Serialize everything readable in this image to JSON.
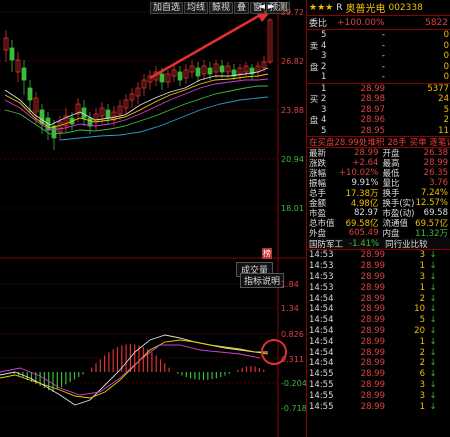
{
  "toolbar": {
    "buttons": [
      "加自选",
      "均线",
      "鲸视",
      "叠",
      "窗",
      "预测"
    ],
    "nav_arrows": "◄ ►"
  },
  "chart": {
    "price_axis": [
      "29.72",
      "26.82",
      "23.88",
      "20.94",
      "18.01"
    ],
    "indicator_axis": [
      "1.84",
      "1.34",
      "0.826",
      "0.311",
      "-0.204",
      "-0.718"
    ],
    "volume_tab": "成交量",
    "indicator_tab": "指标说明",
    "history_mark": "榜"
  },
  "panel": {
    "stars": "★★★",
    "r_mark": "R",
    "name": "奥普光电",
    "code": "002338",
    "weibi_label": "委比",
    "weibi_pct": "+100.00%",
    "weibi_val": "5822",
    "sell_side_label": [
      "卖",
      "盘"
    ],
    "buy_side_label": [
      "买",
      "盘"
    ],
    "sell_orders": [
      {
        "lvl": "5",
        "price": "-",
        "vol": "0"
      },
      {
        "lvl": "4",
        "price": "-",
        "vol": "0"
      },
      {
        "lvl": "3",
        "price": "-",
        "vol": "0"
      },
      {
        "lvl": "2",
        "price": "-",
        "vol": "0"
      },
      {
        "lvl": "1",
        "price": "-",
        "vol": "0"
      }
    ],
    "buy_orders": [
      {
        "lvl": "1",
        "price": "28.99",
        "vol": "5377"
      },
      {
        "lvl": "2",
        "price": "28.98",
        "vol": "24"
      },
      {
        "lvl": "3",
        "price": "28.97",
        "vol": "5"
      },
      {
        "lvl": "4",
        "price": "28.96",
        "vol": "2"
      },
      {
        "lvl": "5",
        "price": "28.95",
        "vol": "11"
      }
    ],
    "sealed_text": "在买盘28.99处堆积",
    "sealed_count": "28手",
    "sealed_link": "买单 逐笔详情",
    "info": [
      {
        "l1": "最新",
        "v1": "28.99",
        "c1": "red",
        "l2": "开盘",
        "v2": "26.38",
        "c2": "red"
      },
      {
        "l1": "涨跌",
        "v1": "+2.64",
        "c1": "red",
        "l2": "最高",
        "v2": "28.99",
        "c2": "red"
      },
      {
        "l1": "涨幅",
        "v1": "+10.02%",
        "c1": "red",
        "l2": "最低",
        "v2": "26.35",
        "c2": "red"
      },
      {
        "l1": "振幅",
        "v1": "9.91%",
        "c1": "white",
        "l2": "量比",
        "v2": "3.76",
        "c2": "red"
      },
      {
        "l1": "总手",
        "v1": "17.38万",
        "c1": "yellow",
        "l2": "换手",
        "v2": "7.24%",
        "c2": "yellow"
      },
      {
        "l1": "金额",
        "v1": "4.98亿",
        "c1": "yellow",
        "l2": "换手(实)",
        "v2": "12.57%",
        "c2": "yellow"
      },
      {
        "l1": "市盈",
        "v1": "82.97",
        "c1": "white",
        "l2": "市盈(动)",
        "v2": "69.58",
        "c2": "white"
      },
      {
        "l1": "总市值",
        "v1": "69.58亿",
        "c1": "yellow",
        "l2": "流通值",
        "v2": "69.57亿",
        "c2": "yellow"
      },
      {
        "l1": "外盘",
        "v1": "605.49",
        "c1": "red",
        "l2": "内盘",
        "v2": "11.32万",
        "c2": "green"
      }
    ],
    "tabs": [
      "国防军工",
      "-1.41%",
      "同行业比较"
    ],
    "ticks": [
      {
        "t": "14:53",
        "p": "28.99",
        "v": "3",
        "d": "↓"
      },
      {
        "t": "14:53",
        "p": "28.99",
        "v": "1",
        "d": "↓"
      },
      {
        "t": "14:53",
        "p": "28.99",
        "v": "3",
        "d": "↓"
      },
      {
        "t": "14:53",
        "p": "28.99",
        "v": "1",
        "d": "↓"
      },
      {
        "t": "14:54",
        "p": "28.99",
        "v": "2",
        "d": "↓"
      },
      {
        "t": "14:54",
        "p": "28.99",
        "v": "10",
        "d": "↓"
      },
      {
        "t": "14:54",
        "p": "28.99",
        "v": "5",
        "d": "↓"
      },
      {
        "t": "14:54",
        "p": "28.99",
        "v": "20",
        "d": "↓"
      },
      {
        "t": "14:54",
        "p": "28.99",
        "v": "1",
        "d": "↓"
      },
      {
        "t": "14:54",
        "p": "28.99",
        "v": "2",
        "d": "↓"
      },
      {
        "t": "14:54",
        "p": "28.99",
        "v": "2",
        "d": "↓"
      },
      {
        "t": "14:55",
        "p": "28.99",
        "v": "6",
        "d": "↓"
      },
      {
        "t": "14:55",
        "p": "28.99",
        "v": "3",
        "d": "↓"
      },
      {
        "t": "14:55",
        "p": "28.99",
        "v": "3",
        "d": "↓"
      },
      {
        "t": "14:55",
        "p": "28.99",
        "v": "1",
        "d": "↓"
      }
    ]
  },
  "colors": {
    "up": "#e04040",
    "down": "#3cba3c",
    "border": "#8b0000",
    "accent": "#f0c000"
  }
}
